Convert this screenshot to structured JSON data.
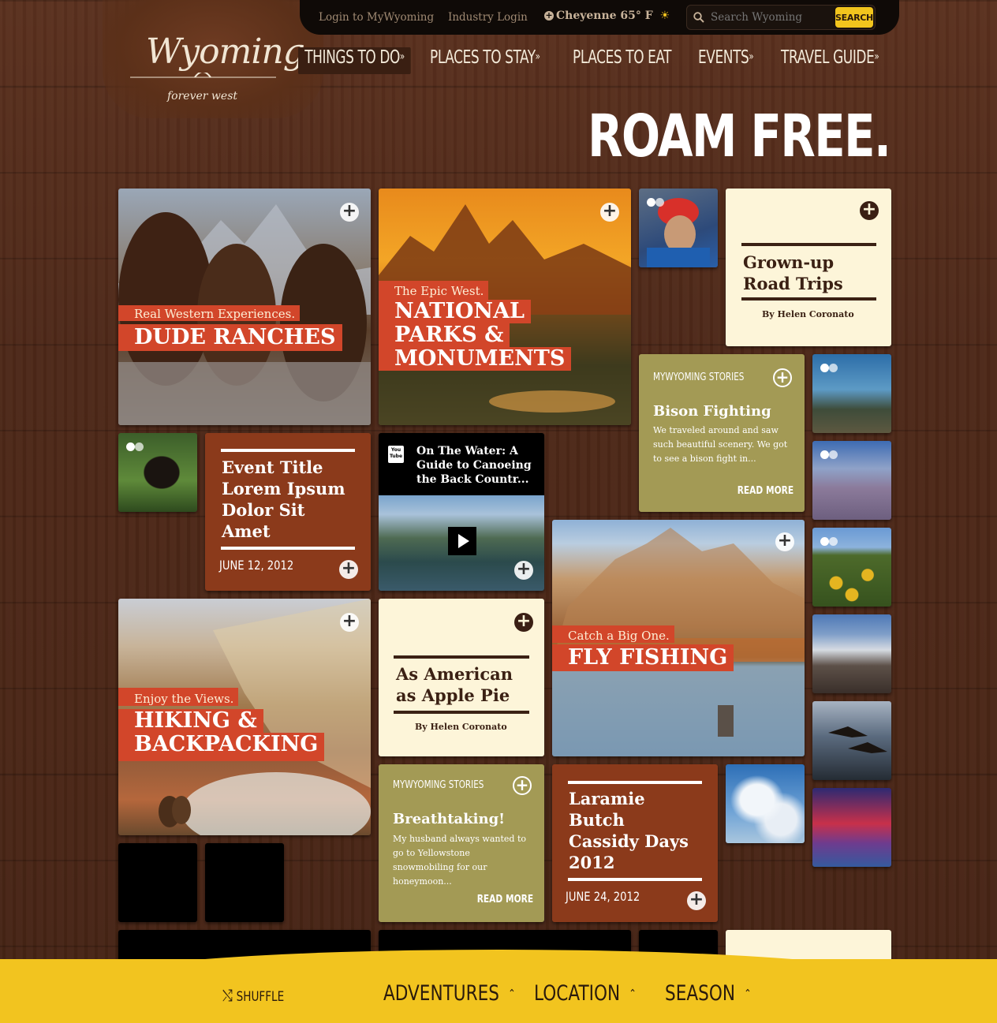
{
  "header": {
    "login_mywyoming": "Login to MyWyoming",
    "industry_login": "Industry Login",
    "weather": "Cheyenne 65° F",
    "search_placeholder": "Search Wyoming",
    "search_button": "SEARCH"
  },
  "logo": {
    "title": "Wyoming",
    "subtitle": "forever west"
  },
  "nav": [
    {
      "label": "THINGS TO DO",
      "has_dropdown": true
    },
    {
      "label": "PLACES TO STAY",
      "has_dropdown": true
    },
    {
      "label": "PLACES TO EAT",
      "has_dropdown": false
    },
    {
      "label": "EVENTS",
      "has_dropdown": true
    },
    {
      "label": "TRAVEL GUIDE",
      "has_dropdown": true
    }
  ],
  "hero": {
    "tagline": "ROAM FREE."
  },
  "tiles": {
    "dude_ranches": {
      "kicker": "Real Western Experiences.",
      "title": "DUDE RANCHES"
    },
    "national_parks": {
      "kicker": "The Epic West.",
      "title_lines": [
        "NATIONAL",
        "PARKS &",
        "MONUMENTS"
      ]
    },
    "road_trips": {
      "title_lines": [
        "Grown-up",
        "Road Trips"
      ],
      "byline": "By Helen Coronato"
    },
    "event_1": {
      "title_lines": [
        "Event Title",
        "Lorem Ipsum",
        "Dolor Sit",
        "Amet"
      ],
      "date": "JUNE 12, 2012"
    },
    "video": {
      "title": "On The Water: A Guide to Canoeing the Back Countr...",
      "badge": "You Tube"
    },
    "bison": {
      "tag": "MYWYOMING STORIES",
      "title": "Bison Fighting",
      "body": "We traveled around and saw such beautiful scenery. We got to see a bison fight in...",
      "read_more": "READ MORE"
    },
    "fly_fishing": {
      "kicker": "Catch a Big One.",
      "title": "FLY FISHING"
    },
    "hiking": {
      "kicker": "Enjoy the Views.",
      "title_lines": [
        "HIKING &",
        "BACKPACKING"
      ]
    },
    "apple_pie": {
      "title_lines": [
        "As American",
        "as Apple Pie"
      ],
      "byline": "By Helen Coronato"
    },
    "breathtaking": {
      "tag": "MYWYOMING STORIES",
      "title": "Breathtaking!",
      "body": "My husband always wanted to go to Yellowstone snowmobiling for our honeymoon...",
      "read_more": "READ MORE"
    },
    "laramie": {
      "title_lines": [
        "Laramie",
        "Butch",
        "Cassidy Days",
        "2012"
      ],
      "date": "JUNE 24, 2012"
    }
  },
  "bottom_bar": {
    "shuffle": "SHUFFLE",
    "adventures": "ADVENTURES",
    "location": "LOCATION",
    "season": "SEASON"
  },
  "colors": {
    "rust": "#8b3a1b",
    "label_red": "#d2462a",
    "cream": "#fdf5d9",
    "olive": "#a39a55",
    "gold": "#f2c41f",
    "wood": "#4d2818"
  }
}
